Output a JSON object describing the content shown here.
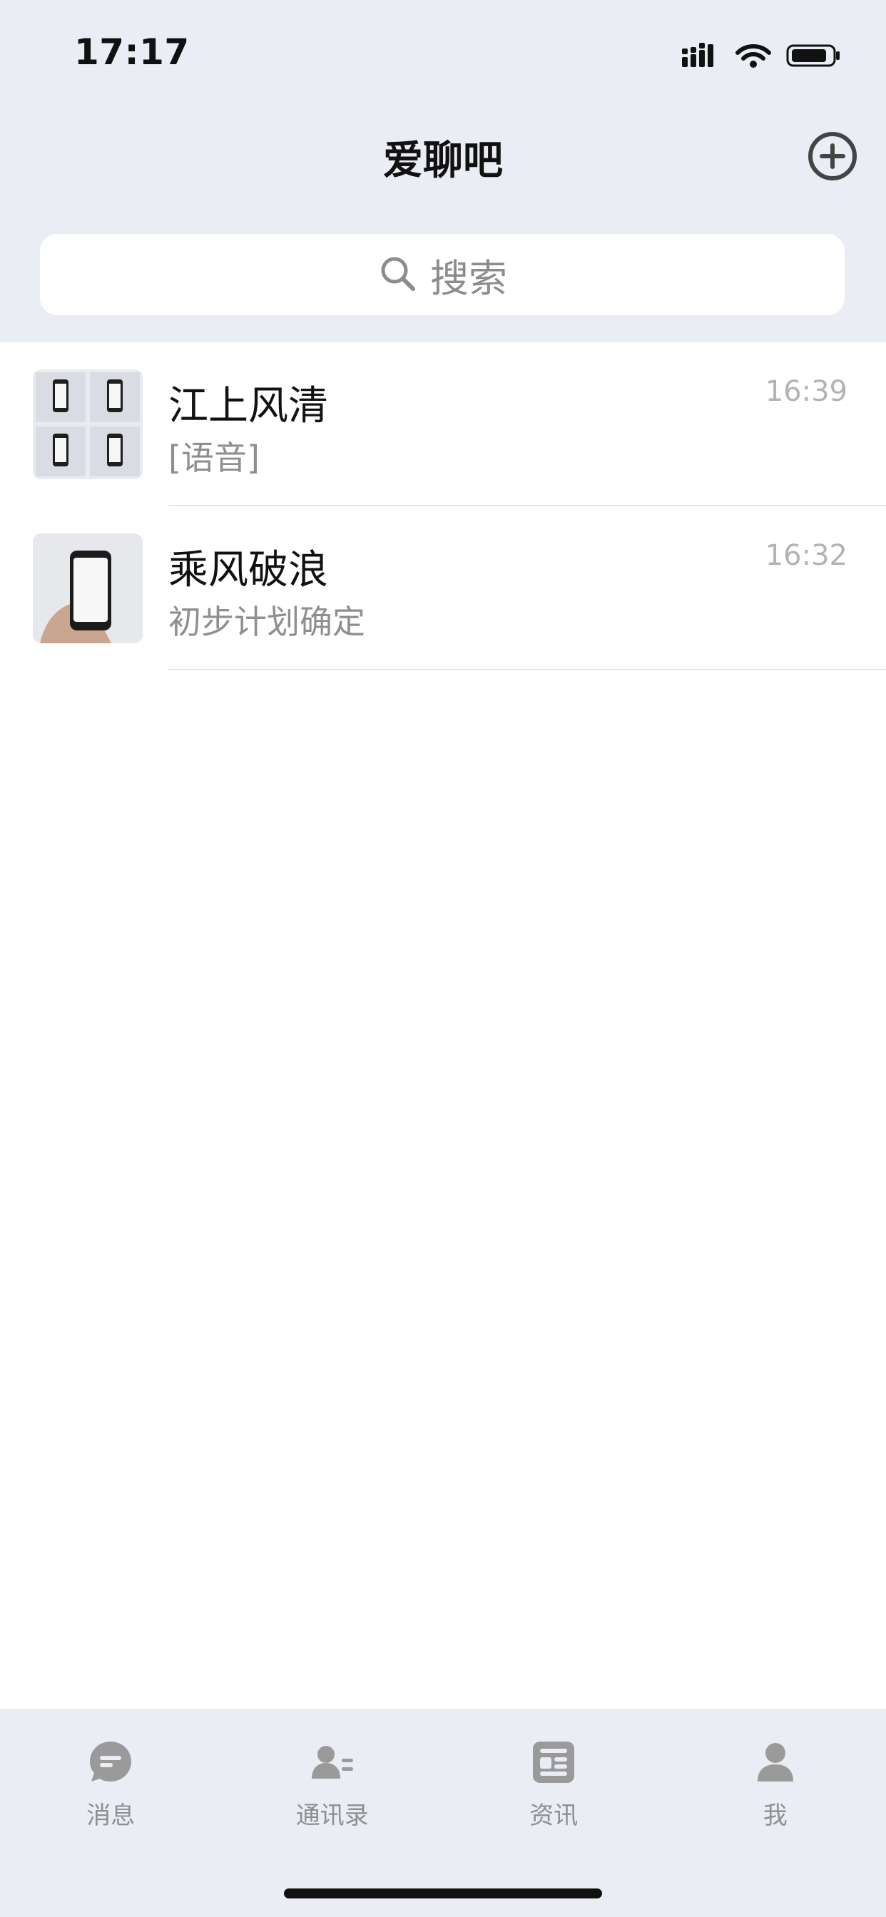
{
  "status_bar": {
    "time": "17:17",
    "icons": [
      "signal-icon",
      "wifi-icon",
      "battery-icon"
    ]
  },
  "nav": {
    "title": "爱聊吧",
    "add_icon": "plus-circle-icon"
  },
  "search": {
    "placeholder": "搜索",
    "icon": "search-icon"
  },
  "chats": [
    {
      "name": "江上风清",
      "preview": "[语音]",
      "time": "16:39",
      "avatar": "group-avatar-4-phones"
    },
    {
      "name": "乘风破浪",
      "preview": "初步计划确定",
      "time": "16:32",
      "avatar": "phone-in-hand-avatar"
    }
  ],
  "tabs": [
    {
      "label": "消息",
      "icon": "message-icon"
    },
    {
      "label": "通讯录",
      "icon": "contacts-icon"
    },
    {
      "label": "资讯",
      "icon": "news-icon"
    },
    {
      "label": "我",
      "icon": "user-icon"
    }
  ],
  "colors": {
    "background_top": "#eaedf4",
    "text_primary": "#111111",
    "text_secondary": "#8f8f8f",
    "tab_icon": "#9a9a9a"
  }
}
